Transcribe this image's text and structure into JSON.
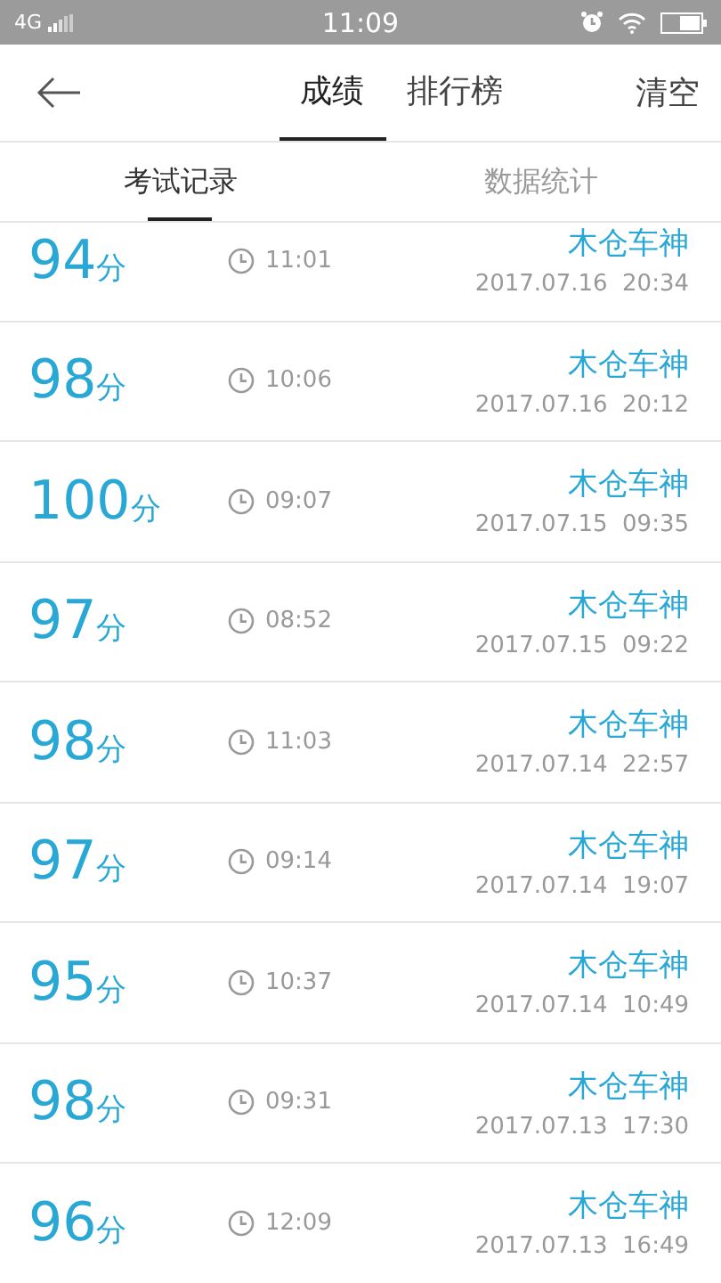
{
  "status_bar": {
    "network": "4G",
    "time": "11:09"
  },
  "nav": {
    "tabs": [
      {
        "label": "成绩",
        "selected": true
      },
      {
        "label": "排行榜",
        "selected": false
      }
    ],
    "action": "清空"
  },
  "sub_tabs": [
    {
      "label": "考试记录",
      "selected": true
    },
    {
      "label": "数据统计",
      "selected": false
    }
  ],
  "records": [
    {
      "score": "94",
      "unit": "分",
      "duration": "11:01",
      "name": "木仓车神",
      "date": "2017.07.16  20:34"
    },
    {
      "score": "98",
      "unit": "分",
      "duration": "10:06",
      "name": "木仓车神",
      "date": "2017.07.16  20:12"
    },
    {
      "score": "100",
      "unit": "分",
      "duration": "09:07",
      "name": "木仓车神",
      "date": "2017.07.15  09:35"
    },
    {
      "score": "97",
      "unit": "分",
      "duration": "08:52",
      "name": "木仓车神",
      "date": "2017.07.15  09:22"
    },
    {
      "score": "98",
      "unit": "分",
      "duration": "11:03",
      "name": "木仓车神",
      "date": "2017.07.14  22:57"
    },
    {
      "score": "97",
      "unit": "分",
      "duration": "09:14",
      "name": "木仓车神",
      "date": "2017.07.14  19:07"
    },
    {
      "score": "95",
      "unit": "分",
      "duration": "10:37",
      "name": "木仓车神",
      "date": "2017.07.14  10:49"
    },
    {
      "score": "98",
      "unit": "分",
      "duration": "09:31",
      "name": "木仓车神",
      "date": "2017.07.13  17:30"
    },
    {
      "score": "96",
      "unit": "分",
      "duration": "12:09",
      "name": "木仓车神",
      "date": "2017.07.13  16:49"
    }
  ]
}
